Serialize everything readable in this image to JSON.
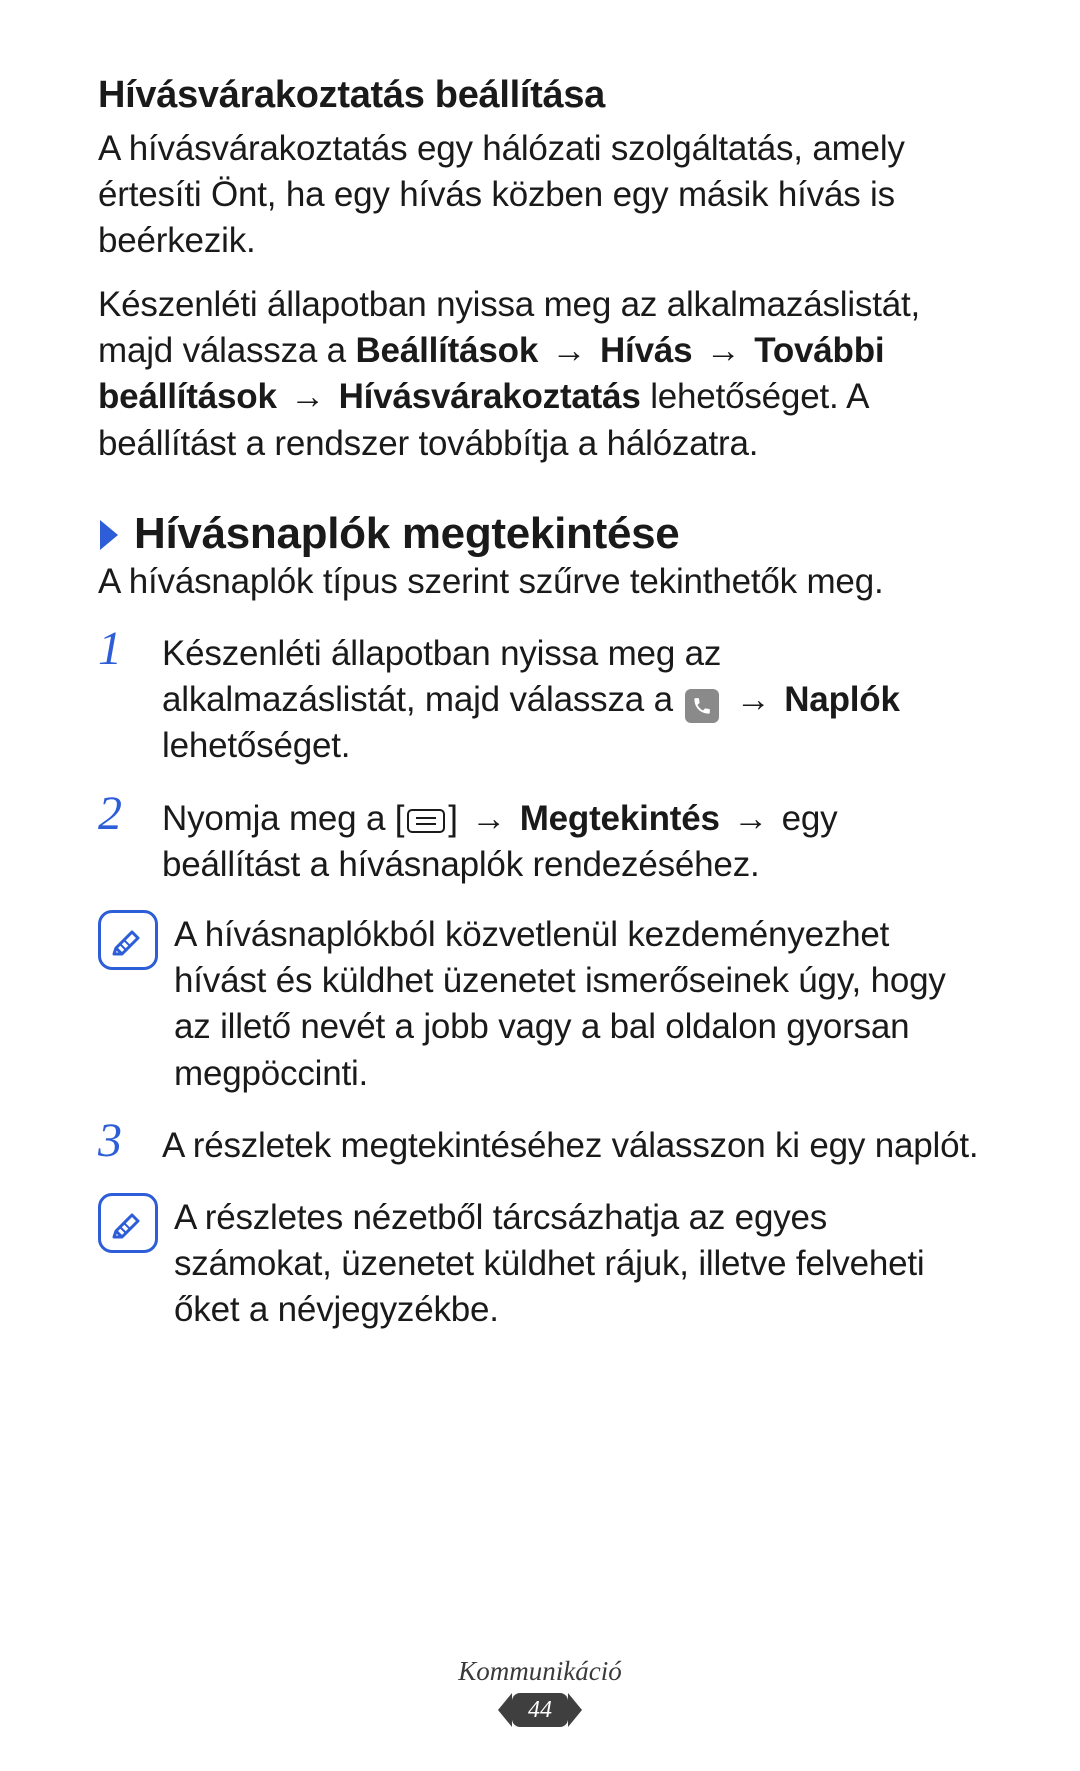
{
  "section1": {
    "heading": "Hívásvárakoztatás beállítása",
    "p1": "A hívásvárakoztatás egy hálózati szolgáltatás, amely értesíti Önt, ha egy hívás közben egy másik hívás is beérkezik.",
    "p2_a": "Készenléti állapotban nyissa meg az alkalmazáslistát, majd válassza a ",
    "p2_b1": "Beállítások",
    "p2_b2": "Hívás",
    "p2_b3": "További beállítások",
    "p2_b4": "Hívásvárakoztatás",
    "p2_c": " lehetőséget. A beállítást a rendszer továbbítja a hálózatra.",
    "arrow": "→"
  },
  "section2": {
    "heading": "Hívásnaplók megtekintése",
    "intro": "A hívásnaplók típus szerint szűrve tekinthetők meg.",
    "steps": {
      "n1": "1",
      "n2": "2",
      "n3": "3",
      "s1_a": "Készenléti állapotban nyissa meg az alkalmazáslistát, majd válassza a ",
      "s1_b": "Naplók",
      "s1_c": " lehetőséget.",
      "s2_a": "Nyomja meg a [",
      "s2_b": "] ",
      "s2_c": "Megtekintés",
      "s2_d": " egy beállítást a hívásnaplók rendezéséhez.",
      "s3": "A részletek megtekintéséhez válasszon ki egy naplót."
    },
    "note1": "A hívásnaplókból közvetlenül kezdeményezhet hívást és küldhet üzenetet ismerőseinek úgy, hogy az illető nevét a jobb vagy a bal oldalon gyorsan megpöccinti.",
    "note2": "A részletes nézetből tárcsázhatja az egyes számokat, üzenetet küldhet rájuk, illetve felveheti őket a névjegyzékbe."
  },
  "footer": {
    "category": "Kommunikáció",
    "page": "44"
  }
}
